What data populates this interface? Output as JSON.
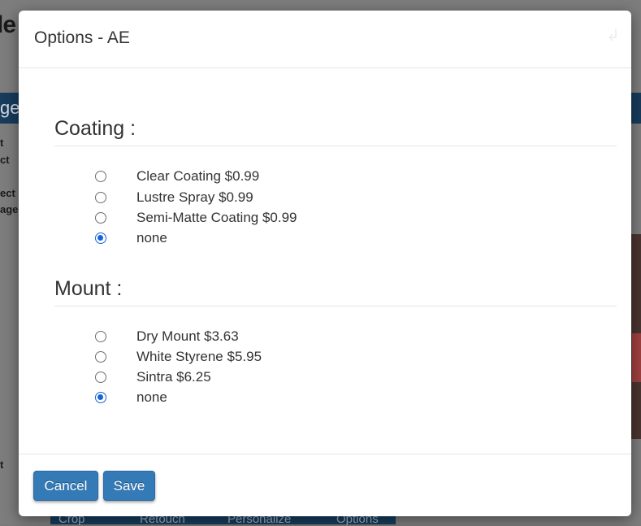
{
  "background": {
    "title": "le",
    "bar_text": "ge",
    "side_texts": [
      "t",
      "ct",
      "ect",
      "age",
      "t"
    ],
    "tools": [
      "Crop",
      "Retouch",
      "Personalize",
      "Options"
    ]
  },
  "modal": {
    "title": "Options - AE",
    "close_icon": "↲"
  },
  "sections": [
    {
      "title": "Coating :",
      "options": [
        {
          "label": "Clear Coating $0.99",
          "checked": false
        },
        {
          "label": "Lustre Spray $0.99",
          "checked": false
        },
        {
          "label": "Semi-Matte Coating $0.99",
          "checked": false
        },
        {
          "label": "none",
          "checked": true
        }
      ]
    },
    {
      "title": "Mount :",
      "options": [
        {
          "label": "Dry Mount $3.63",
          "checked": false
        },
        {
          "label": "White Styrene $5.95",
          "checked": false
        },
        {
          "label": "Sintra $6.25",
          "checked": false
        },
        {
          "label": "none",
          "checked": true
        }
      ]
    }
  ],
  "footer": {
    "cancel_label": "Cancel",
    "save_label": "Save"
  },
  "colors": {
    "primary_button": "#337ab7",
    "radio_checked": "#1565d8",
    "overlay_background": "#7d7d7d"
  }
}
